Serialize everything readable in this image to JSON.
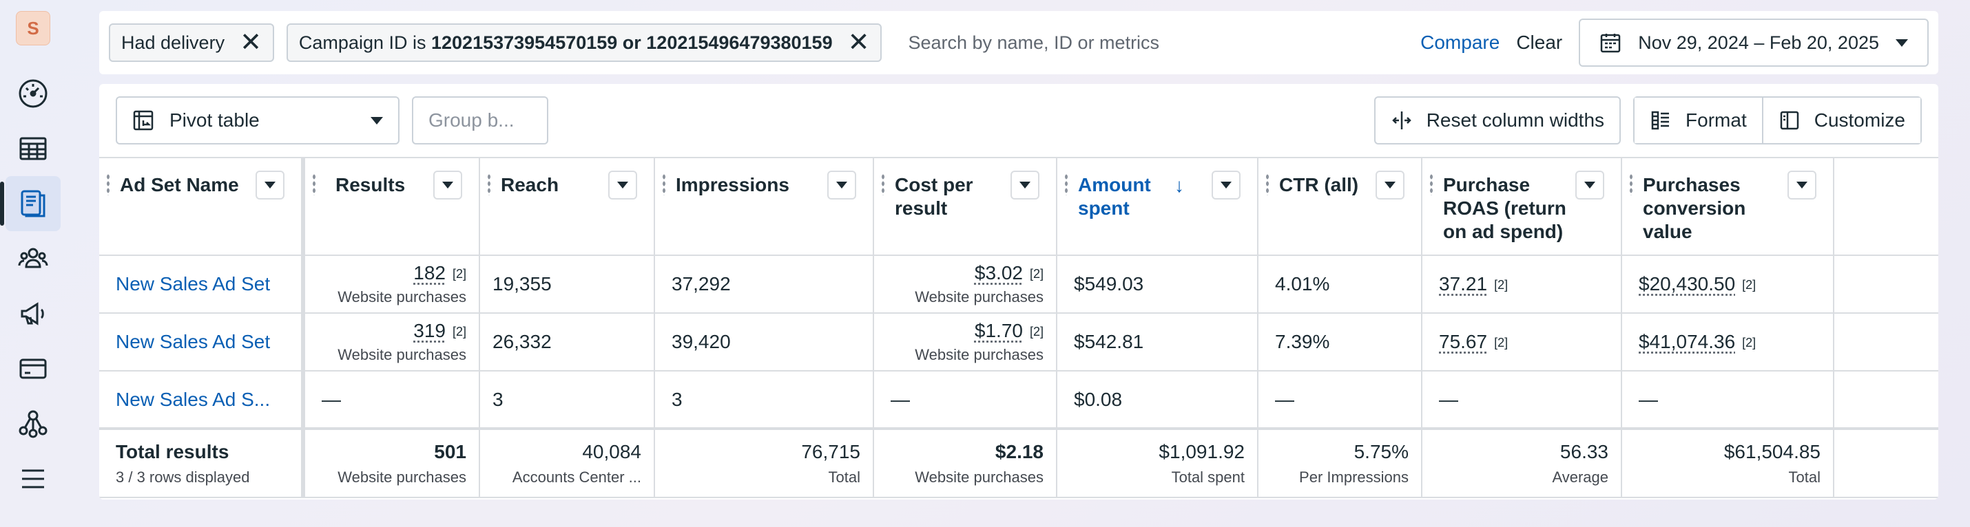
{
  "sidebar": {
    "avatar_letter": "S",
    "items": [
      {
        "icon": "dashboard-gauge-icon",
        "active": false
      },
      {
        "icon": "table-grid-icon",
        "active": false
      },
      {
        "icon": "ads-manager-icon",
        "active": true
      },
      {
        "icon": "audience-people-icon",
        "active": false
      },
      {
        "icon": "megaphone-icon",
        "active": false
      },
      {
        "icon": "billing-card-icon",
        "active": false
      },
      {
        "icon": "network-nodes-icon",
        "active": false
      },
      {
        "icon": "menu-hamburger-icon",
        "active": false
      }
    ]
  },
  "filters": {
    "chip1": "Had delivery",
    "chip2_prefix": "Campaign ID is ",
    "chip2_value": "120215373954570159 or 120215496479380159",
    "search_placeholder": "Search by name, ID or metrics",
    "compare": "Compare",
    "clear": "Clear",
    "date_range": "Nov 29, 2024 – Feb 20, 2025"
  },
  "toolbar": {
    "pivot": "Pivot table",
    "group_by": "Group b...",
    "reset": "Reset column widths",
    "format": "Format",
    "customize": "Customize"
  },
  "columns": [
    "Ad Set Name",
    "Results",
    "Reach",
    "Impressions",
    "Cost per result",
    "Amount spent",
    "CTR (all)",
    "Purchase ROAS (return on ad spend)",
    "Purchases conversion value"
  ],
  "rows": [
    {
      "name": "New Sales Ad Set",
      "results": "182",
      "results_note": "[2]",
      "results_sub": "Website purchases",
      "reach": "19,355",
      "impressions": "37,292",
      "cpr": "$3.02",
      "cpr_note": "[2]",
      "cpr_sub": "Website purchases",
      "spent": "$549.03",
      "ctr": "4.01%",
      "roas": "37.21",
      "roas_note": "[2]",
      "conv": "$20,430.50",
      "conv_note": "[2]"
    },
    {
      "name": "New Sales Ad Set",
      "results": "319",
      "results_note": "[2]",
      "results_sub": "Website purchases",
      "reach": "26,332",
      "impressions": "39,420",
      "cpr": "$1.70",
      "cpr_note": "[2]",
      "cpr_sub": "Website purchases",
      "spent": "$542.81",
      "ctr": "7.39%",
      "roas": "75.67",
      "roas_note": "[2]",
      "conv": "$41,074.36",
      "conv_note": "[2]"
    },
    {
      "name": "New Sales Ad S...",
      "results": "—",
      "reach": "3",
      "impressions": "3",
      "cpr": "—",
      "spent": "$0.08",
      "ctr": "—",
      "roas": "—",
      "conv": "—"
    }
  ],
  "totals": {
    "title": "Total results",
    "subtitle": "3 / 3 rows displayed",
    "results": "501",
    "results_sub": "Website purchases",
    "reach": "40,084",
    "reach_sub": "Accounts Center ...",
    "impressions": "76,715",
    "impressions_sub": "Total",
    "cpr": "$2.18",
    "cpr_sub": "Website purchases",
    "spent": "$1,091.92",
    "spent_sub": "Total spent",
    "ctr": "5.75%",
    "ctr_sub": "Per Impressions",
    "roas": "56.33",
    "roas_sub": "Average",
    "conv": "$61,504.85",
    "conv_sub": "Total"
  },
  "colors": {
    "link": "#0a5fb4",
    "border": "#dadde1",
    "text": "#1c2b33"
  }
}
